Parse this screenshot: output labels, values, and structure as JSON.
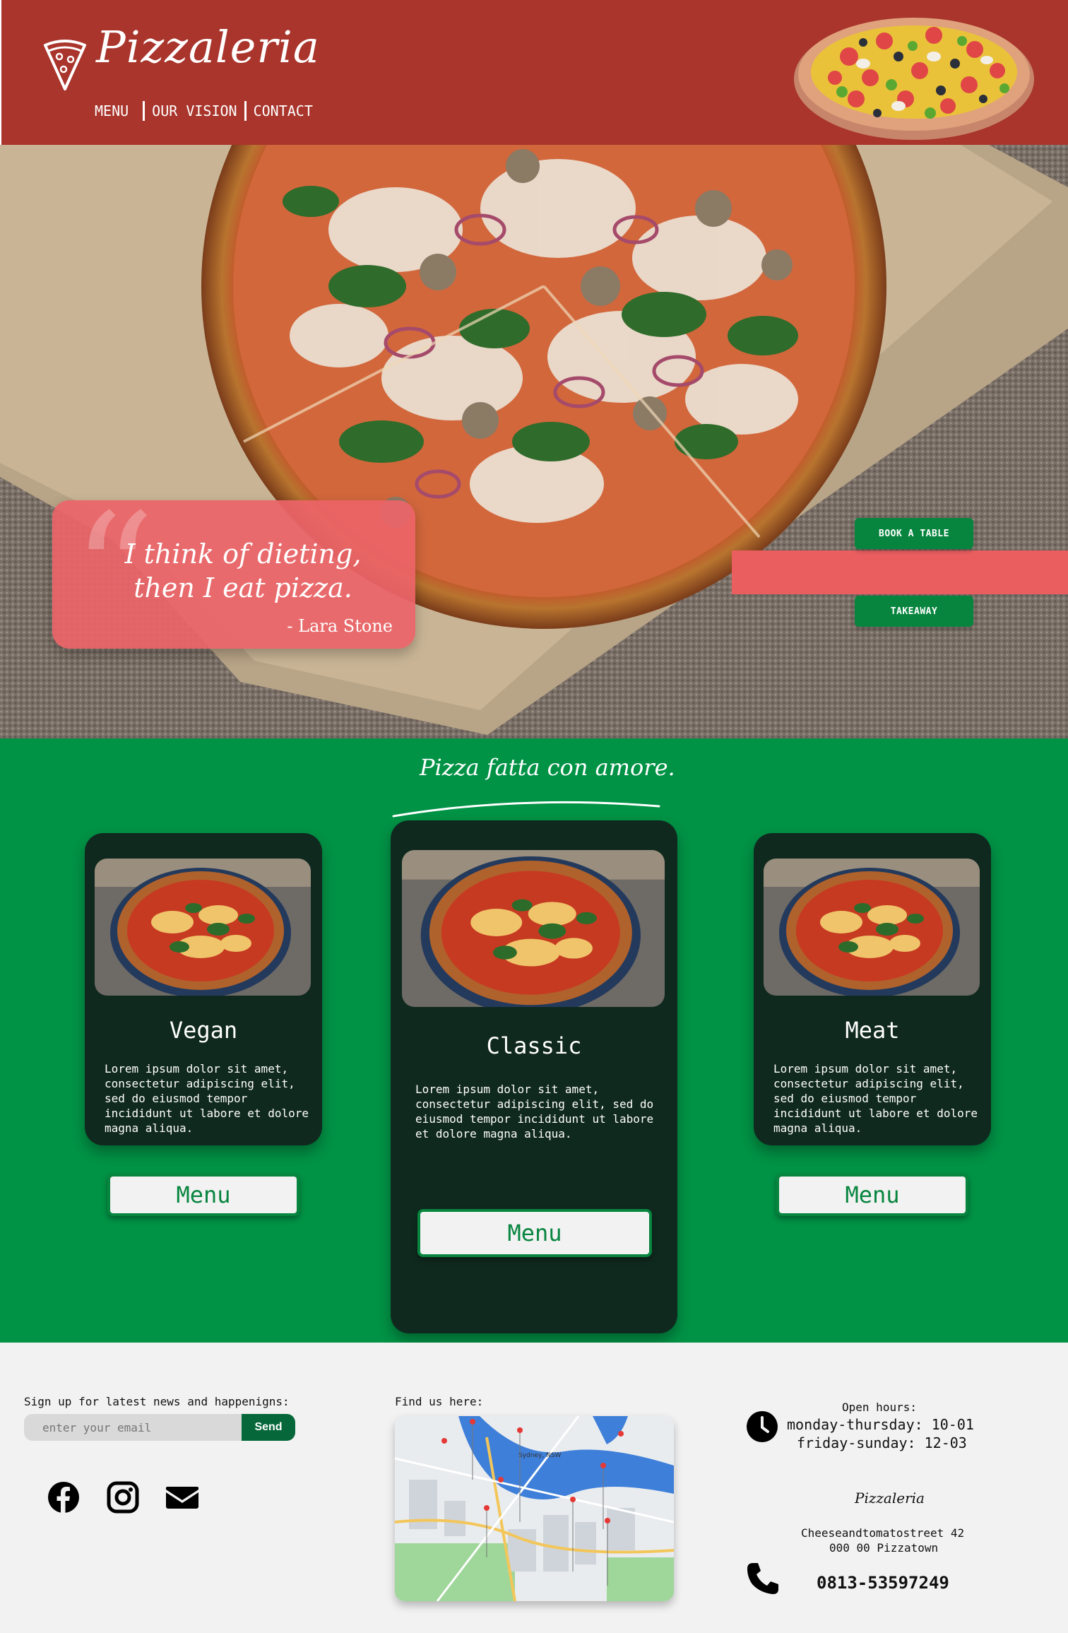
{
  "header": {
    "brand": "Pizzaleria",
    "nav": [
      "MENU",
      "OUR VISION",
      "CONTACT"
    ]
  },
  "hero": {
    "quote": "I think of dieting, then I eat pizza.",
    "author": "- Lara Stone",
    "book_button": "BOOK A TABLE",
    "takeaway_button": "TAKEAWAY"
  },
  "menu_section": {
    "tagline": "Pizza fatta con amore.",
    "cards": [
      {
        "title": "Vegan",
        "description": "Lorem ipsum dolor sit amet, consectetur adipiscing elit, sed do eiusmod tempor incididunt ut labore et dolore magna aliqua.",
        "button": "Menu"
      },
      {
        "title": "Classic",
        "description": "Lorem ipsum dolor sit amet, consectetur adipiscing elit, sed do eiusmod tempor incididunt ut labore et dolore magna aliqua.",
        "button": "Menu"
      },
      {
        "title": "Meat",
        "description": "Lorem ipsum dolor sit amet, consectetur adipiscing elit, sed do eiusmod tempor incididunt ut labore et dolore magna aliqua.",
        "button": "Menu"
      }
    ]
  },
  "footer": {
    "signup_label": "Sign up for latest news and happenigns:",
    "email_placeholder": "enter your email",
    "send_button": "Send",
    "find_label": "Find us here:",
    "map_label": "Sydney, NSW",
    "open_label": "Open hours:",
    "hours_weekdays": "monday-thursday: 10-01",
    "hours_weekend": "friday-sunday: 12-03",
    "brand": "Pizzaleria",
    "address_line1": "Cheeseandtomatostreet 42",
    "address_line2": "000 00 Pizzatown",
    "phone": "0813-53597249"
  },
  "icons": [
    "pizza-slice-icon",
    "facebook-icon",
    "instagram-icon",
    "envelope-icon",
    "clock-icon",
    "phone-icon",
    "map-pin-icon"
  ],
  "colors": {
    "header_red": "#a9352c",
    "quote_pink": "#ea5e5f",
    "green": "#009245",
    "button_green": "#07853f",
    "card_dark": "#10291f",
    "footer_bg": "#f2f2f2"
  }
}
